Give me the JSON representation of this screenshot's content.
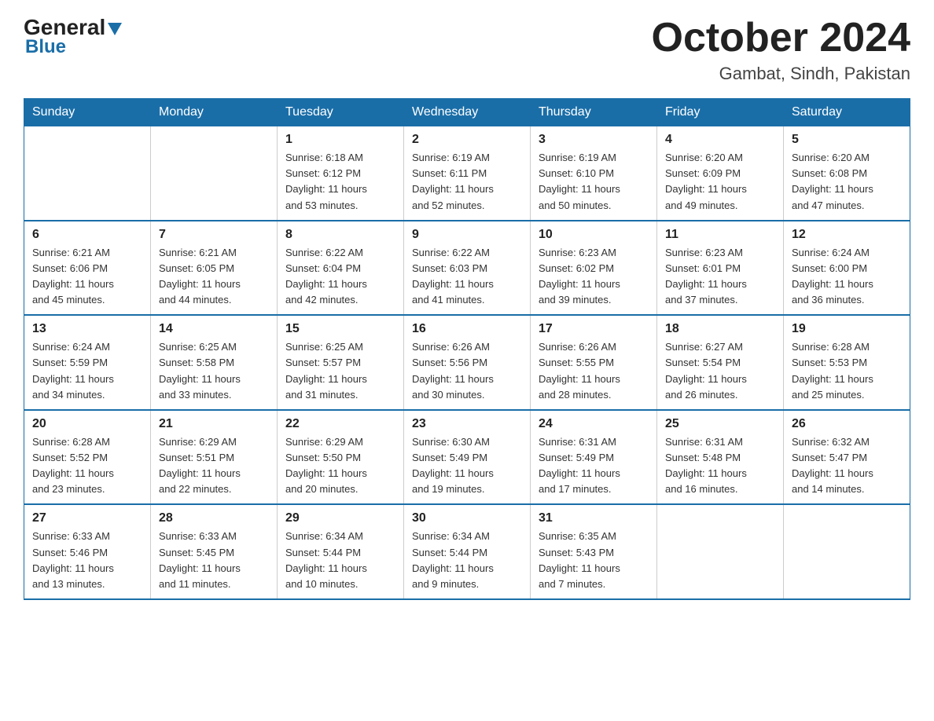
{
  "logo": {
    "general": "General",
    "blue": "Blue"
  },
  "title": "October 2024",
  "location": "Gambat, Sindh, Pakistan",
  "weekdays": [
    "Sunday",
    "Monday",
    "Tuesday",
    "Wednesday",
    "Thursday",
    "Friday",
    "Saturday"
  ],
  "weeks": [
    [
      {
        "day": "",
        "info": ""
      },
      {
        "day": "",
        "info": ""
      },
      {
        "day": "1",
        "info": "Sunrise: 6:18 AM\nSunset: 6:12 PM\nDaylight: 11 hours\nand 53 minutes."
      },
      {
        "day": "2",
        "info": "Sunrise: 6:19 AM\nSunset: 6:11 PM\nDaylight: 11 hours\nand 52 minutes."
      },
      {
        "day": "3",
        "info": "Sunrise: 6:19 AM\nSunset: 6:10 PM\nDaylight: 11 hours\nand 50 minutes."
      },
      {
        "day": "4",
        "info": "Sunrise: 6:20 AM\nSunset: 6:09 PM\nDaylight: 11 hours\nand 49 minutes."
      },
      {
        "day": "5",
        "info": "Sunrise: 6:20 AM\nSunset: 6:08 PM\nDaylight: 11 hours\nand 47 minutes."
      }
    ],
    [
      {
        "day": "6",
        "info": "Sunrise: 6:21 AM\nSunset: 6:06 PM\nDaylight: 11 hours\nand 45 minutes."
      },
      {
        "day": "7",
        "info": "Sunrise: 6:21 AM\nSunset: 6:05 PM\nDaylight: 11 hours\nand 44 minutes."
      },
      {
        "day": "8",
        "info": "Sunrise: 6:22 AM\nSunset: 6:04 PM\nDaylight: 11 hours\nand 42 minutes."
      },
      {
        "day": "9",
        "info": "Sunrise: 6:22 AM\nSunset: 6:03 PM\nDaylight: 11 hours\nand 41 minutes."
      },
      {
        "day": "10",
        "info": "Sunrise: 6:23 AM\nSunset: 6:02 PM\nDaylight: 11 hours\nand 39 minutes."
      },
      {
        "day": "11",
        "info": "Sunrise: 6:23 AM\nSunset: 6:01 PM\nDaylight: 11 hours\nand 37 minutes."
      },
      {
        "day": "12",
        "info": "Sunrise: 6:24 AM\nSunset: 6:00 PM\nDaylight: 11 hours\nand 36 minutes."
      }
    ],
    [
      {
        "day": "13",
        "info": "Sunrise: 6:24 AM\nSunset: 5:59 PM\nDaylight: 11 hours\nand 34 minutes."
      },
      {
        "day": "14",
        "info": "Sunrise: 6:25 AM\nSunset: 5:58 PM\nDaylight: 11 hours\nand 33 minutes."
      },
      {
        "day": "15",
        "info": "Sunrise: 6:25 AM\nSunset: 5:57 PM\nDaylight: 11 hours\nand 31 minutes."
      },
      {
        "day": "16",
        "info": "Sunrise: 6:26 AM\nSunset: 5:56 PM\nDaylight: 11 hours\nand 30 minutes."
      },
      {
        "day": "17",
        "info": "Sunrise: 6:26 AM\nSunset: 5:55 PM\nDaylight: 11 hours\nand 28 minutes."
      },
      {
        "day": "18",
        "info": "Sunrise: 6:27 AM\nSunset: 5:54 PM\nDaylight: 11 hours\nand 26 minutes."
      },
      {
        "day": "19",
        "info": "Sunrise: 6:28 AM\nSunset: 5:53 PM\nDaylight: 11 hours\nand 25 minutes."
      }
    ],
    [
      {
        "day": "20",
        "info": "Sunrise: 6:28 AM\nSunset: 5:52 PM\nDaylight: 11 hours\nand 23 minutes."
      },
      {
        "day": "21",
        "info": "Sunrise: 6:29 AM\nSunset: 5:51 PM\nDaylight: 11 hours\nand 22 minutes."
      },
      {
        "day": "22",
        "info": "Sunrise: 6:29 AM\nSunset: 5:50 PM\nDaylight: 11 hours\nand 20 minutes."
      },
      {
        "day": "23",
        "info": "Sunrise: 6:30 AM\nSunset: 5:49 PM\nDaylight: 11 hours\nand 19 minutes."
      },
      {
        "day": "24",
        "info": "Sunrise: 6:31 AM\nSunset: 5:49 PM\nDaylight: 11 hours\nand 17 minutes."
      },
      {
        "day": "25",
        "info": "Sunrise: 6:31 AM\nSunset: 5:48 PM\nDaylight: 11 hours\nand 16 minutes."
      },
      {
        "day": "26",
        "info": "Sunrise: 6:32 AM\nSunset: 5:47 PM\nDaylight: 11 hours\nand 14 minutes."
      }
    ],
    [
      {
        "day": "27",
        "info": "Sunrise: 6:33 AM\nSunset: 5:46 PM\nDaylight: 11 hours\nand 13 minutes."
      },
      {
        "day": "28",
        "info": "Sunrise: 6:33 AM\nSunset: 5:45 PM\nDaylight: 11 hours\nand 11 minutes."
      },
      {
        "day": "29",
        "info": "Sunrise: 6:34 AM\nSunset: 5:44 PM\nDaylight: 11 hours\nand 10 minutes."
      },
      {
        "day": "30",
        "info": "Sunrise: 6:34 AM\nSunset: 5:44 PM\nDaylight: 11 hours\nand 9 minutes."
      },
      {
        "day": "31",
        "info": "Sunrise: 6:35 AM\nSunset: 5:43 PM\nDaylight: 11 hours\nand 7 minutes."
      },
      {
        "day": "",
        "info": ""
      },
      {
        "day": "",
        "info": ""
      }
    ]
  ]
}
